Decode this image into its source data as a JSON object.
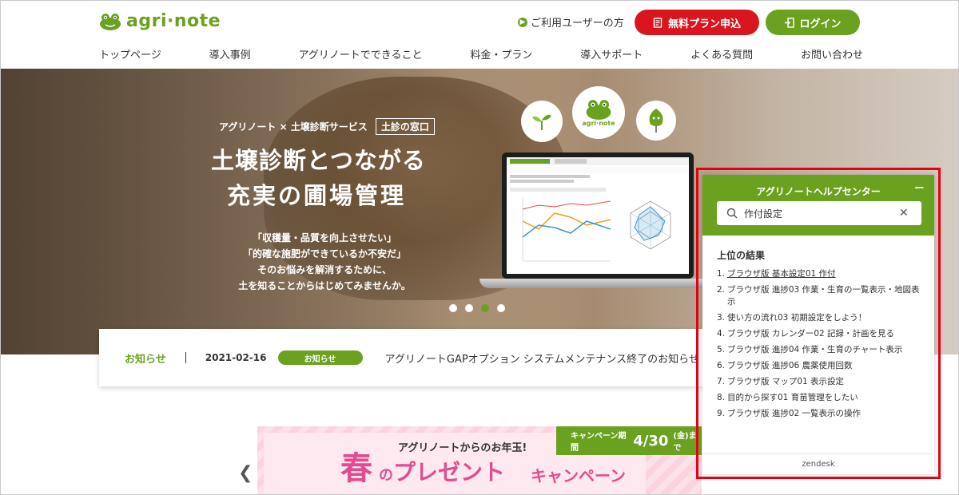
{
  "header": {
    "logo_text": "agri·note",
    "user_link": "ご利用ユーザーの方",
    "free_plan_button": "無料プラン申込",
    "login_button": "ログイン",
    "brand_color": "#6aa220",
    "accent_red": "#d9151e"
  },
  "nav": {
    "items": [
      "トップページ",
      "導入事例",
      "アグリノートでできること",
      "料金・プラン",
      "導入サポート",
      "よくある質問",
      "お問い合わせ"
    ]
  },
  "hero": {
    "subtitle": "アグリノート × 土壌診断サービス",
    "tag": "土診の窓口",
    "title_line1": "土壌診断とつながる",
    "title_line2": "充実の圃場管理",
    "body_line1": "「収穫量・品質を向上させたい」",
    "body_line2": "「的確な施肥ができているか不安だ」",
    "body_line3": "そのお悩みを解消するために、",
    "body_line4": "土を知ることからはじめてみませんか。",
    "bubble_mid": "agri·note",
    "slide_count": 4,
    "active_slide": 3
  },
  "news": {
    "label": "お知らせ",
    "date": "2021-02-16",
    "badge": "お知らせ",
    "text": "アグリノートGAPオプション システムメンテナンス終了のお知らせ"
  },
  "banner": {
    "subtitle": "アグリノートからのお年玉!",
    "tag_label": "キャンペーン期間",
    "tag_date": "4/30",
    "tag_suffix": "(金)まで",
    "haru": "春",
    "no": "の",
    "main": "プレゼント",
    "campaign": "キャンペーン"
  },
  "help": {
    "title": "アグリノートヘルプセンター",
    "search_value": "作付設定",
    "results_heading": "上位の結果",
    "results": [
      "ブラウザ版 基本設定01 作付",
      "ブラウザ版 進捗03 作業・生育の一覧表示・地図表示",
      "使い方の流れ03 初期設定をしよう！",
      "ブラウザ版 カレンダー02 記録・計画を見る",
      "ブラウザ版 進捗04 作業・生育のチャート表示",
      "ブラウザ版 進捗06 農薬使用回数",
      "ブラウザ版 マップ01 表示設定",
      "目的から探す01 育苗管理をしたい",
      "ブラウザ版 進捗02 一覧表示の操作"
    ],
    "footer": "zendesk",
    "highlight_color": "#e60012"
  }
}
